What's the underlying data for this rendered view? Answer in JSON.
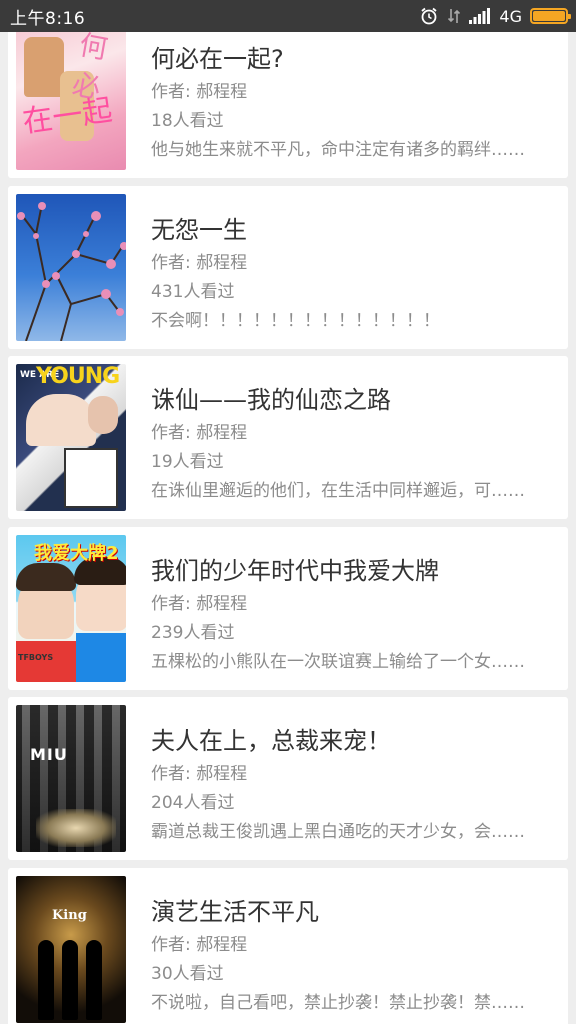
{
  "status_bar": {
    "time": "上午8:16",
    "network": "4G",
    "battery_level": 1.0,
    "icons": [
      "alarm-icon",
      "data-arrows-icon",
      "signal-icon",
      "battery-icon"
    ],
    "accent": "#f5a623"
  },
  "books": [
    {
      "title": "何必在一起?",
      "author": "作者: 郝程程",
      "views": "18人看过",
      "desc": "他与她生来就不平凡，命中注定有诸多的羁绊……"
    },
    {
      "title": "无怨一生",
      "author": "作者: 郝程程",
      "views": "431人看过",
      "desc": "不会啊！！！！！！！！！！！！！！"
    },
    {
      "title": "诛仙——我的仙恋之路",
      "author": "作者: 郝程程",
      "views": "19人看过",
      "desc": "在诛仙里邂逅的他们，在生活中同样邂逅，可……"
    },
    {
      "title": "我们的少年时代中我爱大牌",
      "author": "作者: 郝程程",
      "views": "239人看过",
      "desc": "五棵松的小熊队在一次联谊赛上输给了一个女……"
    },
    {
      "title": "夫人在上，总裁来宠！",
      "author": "作者: 郝程程",
      "views": "204人看过",
      "desc": "霸道总裁王俊凯遇上黑白通吃的天才少女，会……"
    },
    {
      "title": "演艺生活不平凡",
      "author": "作者: 郝程程",
      "views": "30人看过",
      "desc": "不说啦，自己看吧，禁止抄袭！禁止抄袭！禁……"
    }
  ],
  "covers": {
    "c1_text_a": "在一起",
    "c1_text_b": "何必",
    "c3_we": "WE ARE",
    "c3_young": "YOUNG",
    "c4_title": "我爱大牌2",
    "c4_band": "TFBOYS",
    "c5_sign": "MIU",
    "c6_king": "King"
  }
}
